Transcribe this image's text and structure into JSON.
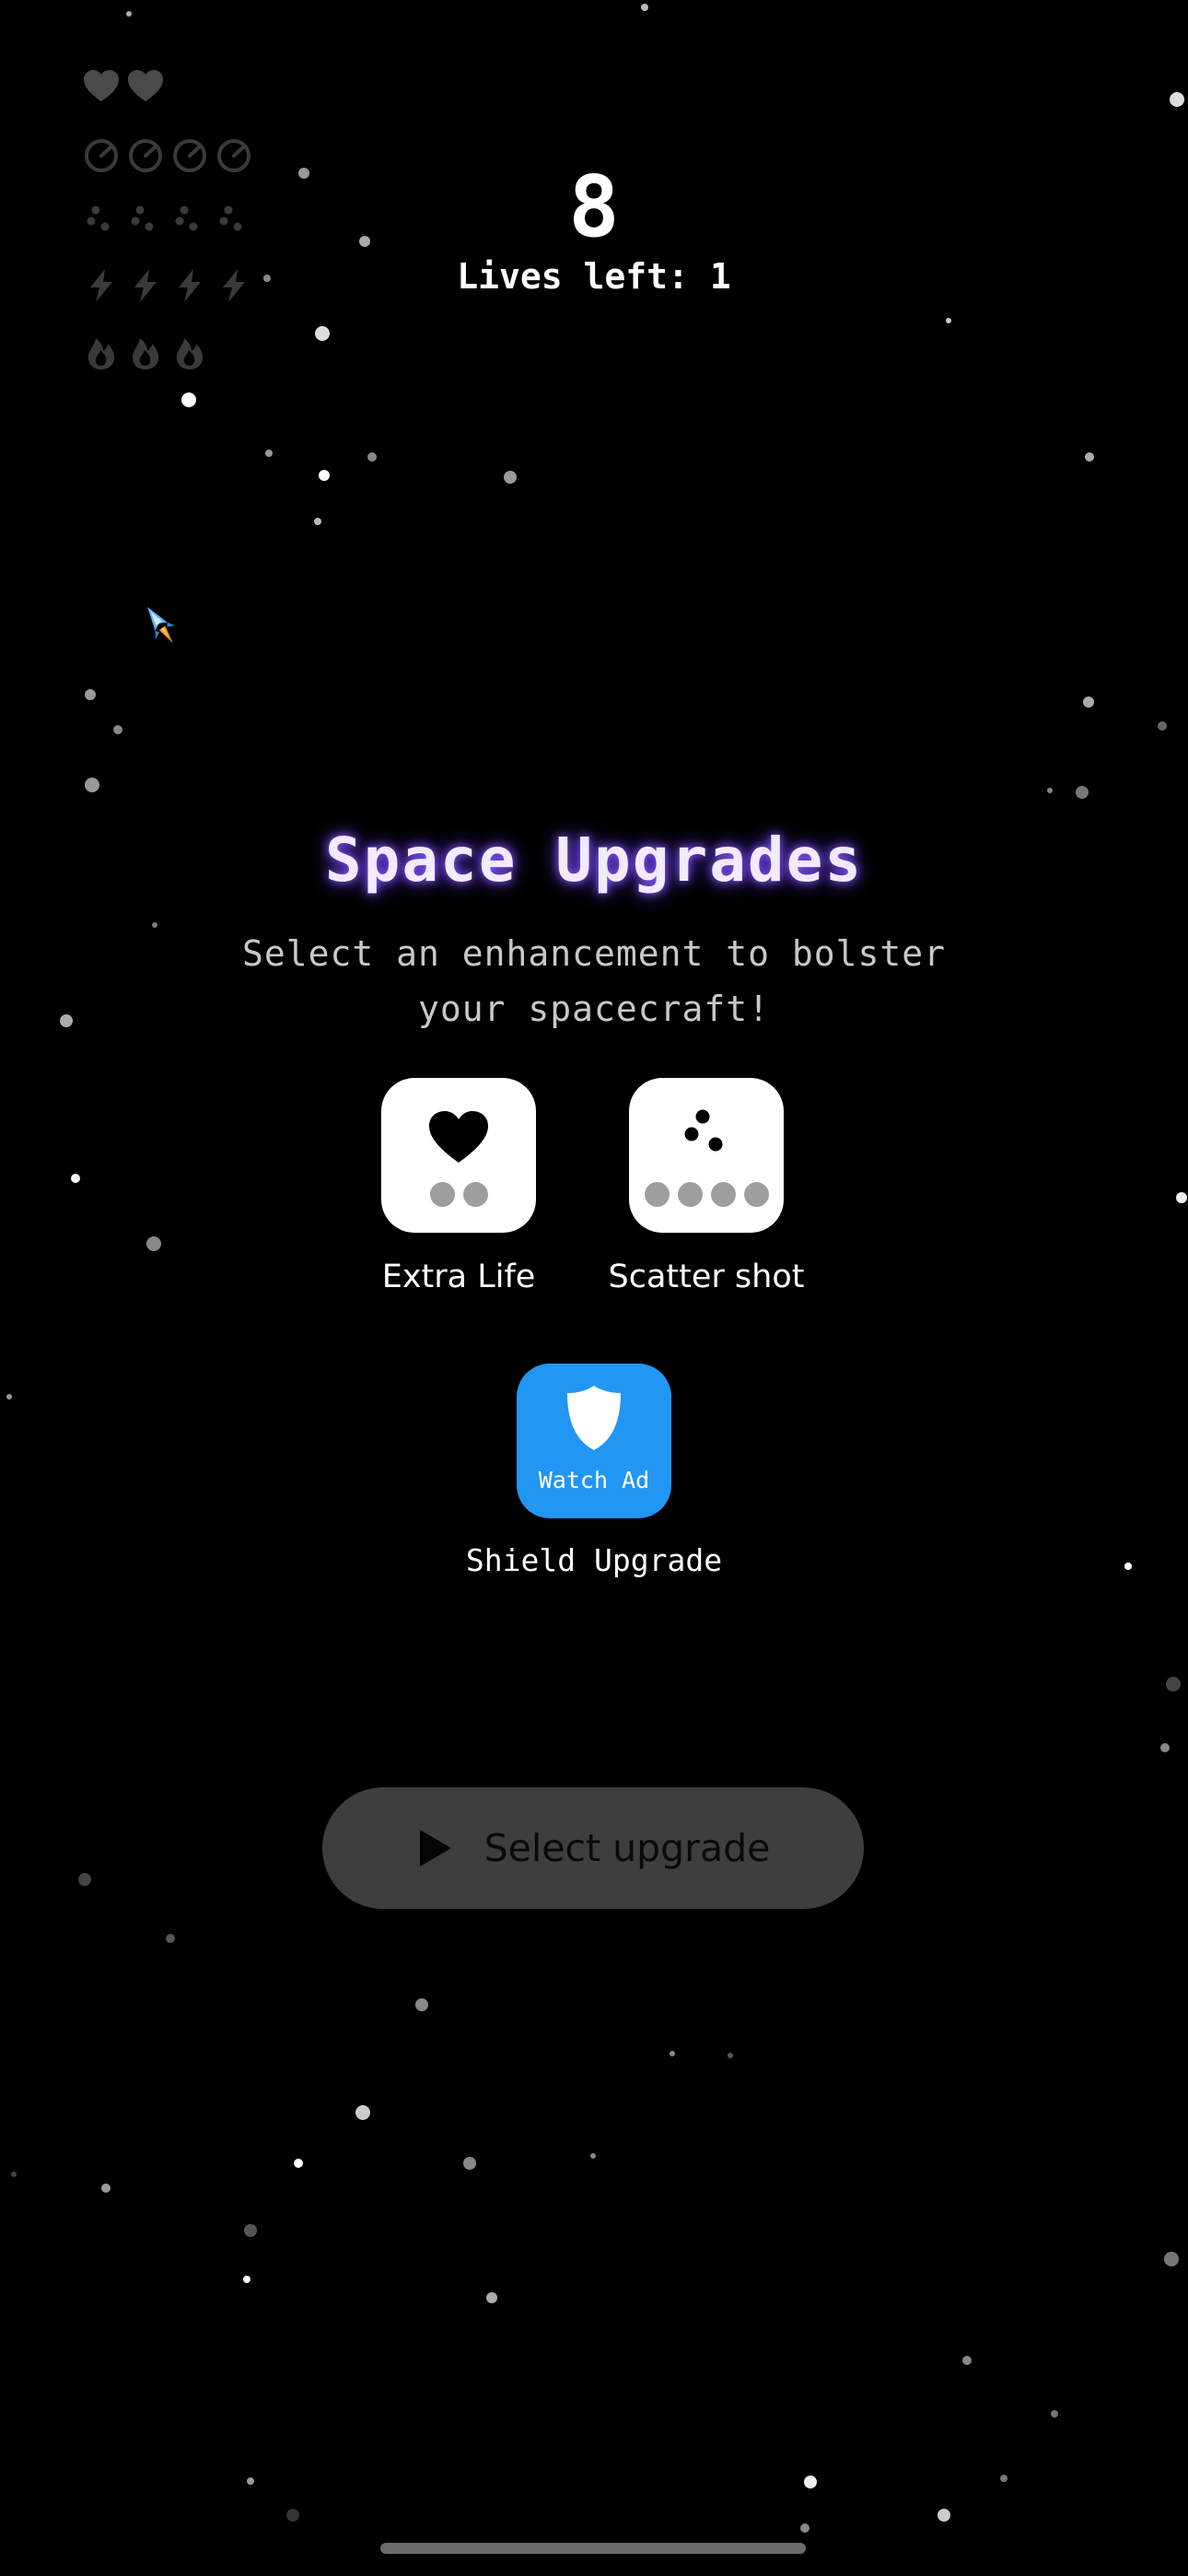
{
  "hud": {
    "lives_icon": "heart-icon",
    "lives_count": 2,
    "speed_icon": "speedometer-icon",
    "speed_count": 4,
    "multishot_icon": "triple-dot-icon",
    "multishot_count": 4,
    "power_icon": "lightning-icon",
    "power_count": 4,
    "fire_icon": "flame-icon",
    "fire_count": 3,
    "inactive_color": "#3a3a3a",
    "active_color": "#4a4a4a"
  },
  "score": "8",
  "lives_text": "Lives left: 1",
  "ship_icon": "spaceship-icon",
  "dialog": {
    "title": "Space Upgrades",
    "subtitle": "Select an enhancement to bolster your spacecraft!",
    "title_glow_color": "#7b4dff"
  },
  "upgrades": [
    {
      "label": "Extra Life",
      "icon": "heart-icon",
      "level_dots": 2
    },
    {
      "label": "Scatter shot",
      "icon": "scatter-icon",
      "level_dots": 4
    },
    {
      "label": "Shield Upgrade",
      "icon": "shield-icon",
      "badge": "Watch Ad",
      "tile_color": "#2196f3"
    }
  ],
  "cta": {
    "label": "Select upgrade",
    "icon": "play-icon"
  }
}
